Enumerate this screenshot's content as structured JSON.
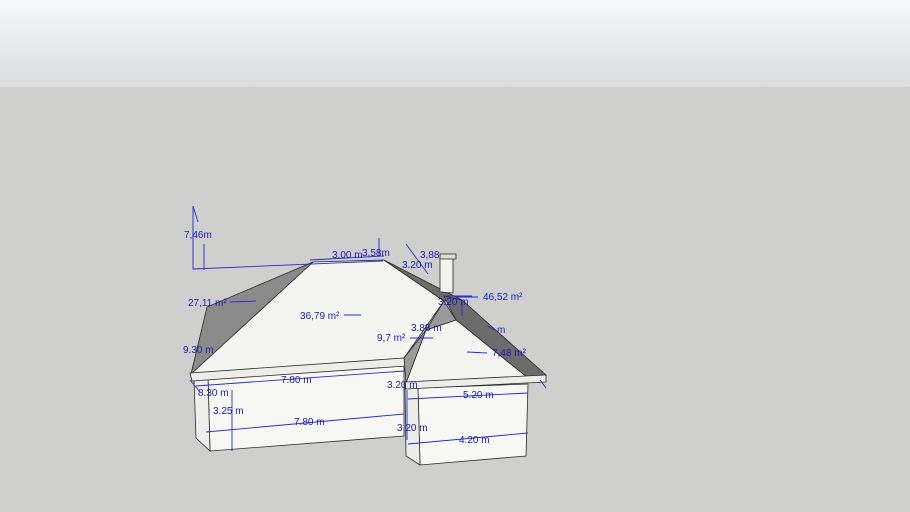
{
  "scene": {
    "colors": {
      "sky_top": "#f6f8f9",
      "sky_bottom": "#d8dbdc",
      "ground": "#cfcfcd",
      "roof_light": "#f4f4f0",
      "roof_dark": "#7b7b7b",
      "wall": "#f7f7f4",
      "edge": "#2a2a2a",
      "dimension": "#1a1ab8"
    },
    "dimension_labels": {
      "height_total": "7,46m",
      "roof_top_length": "3.00 m",
      "roof_top_short": "3,58m",
      "chimney_depth": "3,88",
      "chimney_width": "3.20 m",
      "area_left_hip": "27,11 m²",
      "area_main_roof": "36,79 m²",
      "area_right_roof": "46,52 m²",
      "area_small_roof": "9,7 m²",
      "area_wing_hip": "7,48 m²",
      "valley_length": "3.88 m",
      "ridge_wing": "3.20 m",
      "right_m": "m",
      "left_side_depth": "9.30 m",
      "eave_main": "7.80 m",
      "eave_wing_depth": "3.20 m",
      "base_left_depth": "8.30 m",
      "wall_height": "3.25 m",
      "wall_main_bottom": "7.80 m",
      "wing_front": "5.20 m",
      "wing_height": "3.20 m",
      "wing_bottom": "4.20 m"
    }
  }
}
